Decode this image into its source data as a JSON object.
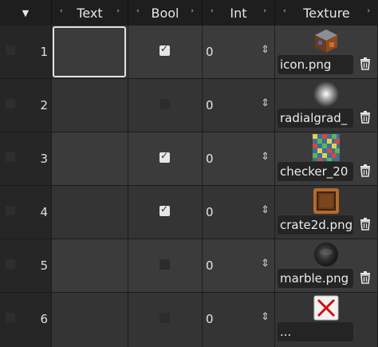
{
  "header": {
    "corner_caret": "▼",
    "columns": [
      "Text",
      "Bool",
      "Int",
      "Texture"
    ],
    "arrow_left": "‹",
    "arrow_right": "›"
  },
  "rows": [
    {
      "num": "1",
      "text": "",
      "bool": true,
      "int": "0",
      "texture": "icon.png",
      "thumb_icon": "cube-icon"
    },
    {
      "num": "2",
      "text": "",
      "bool": false,
      "int": "0",
      "texture": "radialgrad_",
      "thumb_icon": "radial-gradient-icon"
    },
    {
      "num": "3",
      "text": "",
      "bool": true,
      "int": "0",
      "texture": "checker_20",
      "thumb_icon": "checker-icon"
    },
    {
      "num": "4",
      "text": "",
      "bool": true,
      "int": "0",
      "texture": "crate2d.png",
      "thumb_icon": "crate-icon"
    },
    {
      "num": "5",
      "text": "",
      "bool": false,
      "int": "0",
      "texture": "marble.png",
      "thumb_icon": "marble-icon"
    },
    {
      "num": "6",
      "text": "",
      "bool": false,
      "int": "0",
      "texture": "...",
      "thumb_icon": "missing-texture-icon"
    }
  ],
  "colors": {
    "background": "#2a2a2a",
    "header": "#1e1e1e",
    "row_odd": "#3b3b3b",
    "row_even": "#343434",
    "focus_border": "#e0e0e0"
  }
}
